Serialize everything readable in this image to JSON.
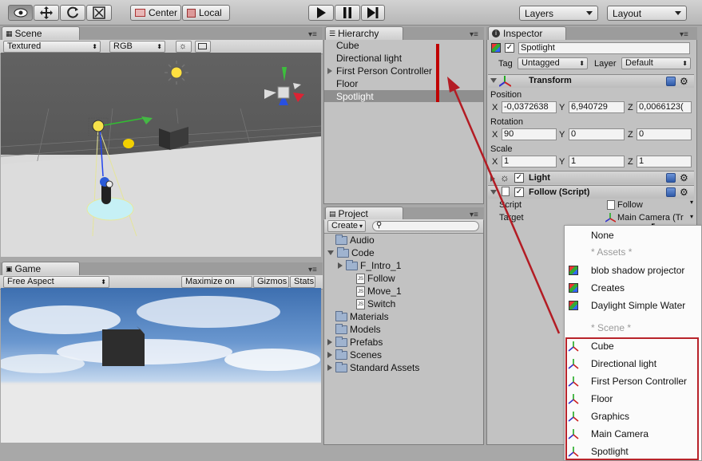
{
  "toolbar": {
    "tools": [
      "view-icon",
      "move-icon",
      "rotate-icon",
      "scale-icon"
    ],
    "pivot_label": "Center",
    "space_label": "Local",
    "layers_label": "Layers",
    "layout_label": "Layout"
  },
  "scene": {
    "tab_label": "Scene",
    "render_mode": "Textured",
    "color_mode": "RGB"
  },
  "game": {
    "tab_label": "Game",
    "aspect": "Free Aspect",
    "maximize_label": "Maximize on Play",
    "gizmos_label": "Gizmos",
    "stats_label": "Stats"
  },
  "hierarchy": {
    "tab_label": "Hierarchy",
    "items": [
      "Cube",
      "Directional light",
      "First Person Controller",
      "Floor",
      "Spotlight"
    ],
    "selected": "Spotlight"
  },
  "project": {
    "tab_label": "Project",
    "create_label": "Create",
    "tree": [
      {
        "label": "Audio",
        "kind": "folder",
        "indent": 0,
        "arrow": ""
      },
      {
        "label": "Code",
        "kind": "folder",
        "indent": 0,
        "arrow": "down"
      },
      {
        "label": "F_Intro_1",
        "kind": "folder",
        "indent": 1,
        "arrow": "right"
      },
      {
        "label": "Follow",
        "kind": "js",
        "indent": 2,
        "arrow": ""
      },
      {
        "label": "Move_1",
        "kind": "js",
        "indent": 2,
        "arrow": ""
      },
      {
        "label": "Switch",
        "kind": "js",
        "indent": 2,
        "arrow": ""
      },
      {
        "label": "Materials",
        "kind": "folder",
        "indent": 0,
        "arrow": ""
      },
      {
        "label": "Models",
        "kind": "folder",
        "indent": 0,
        "arrow": ""
      },
      {
        "label": "Prefabs",
        "kind": "folder",
        "indent": 0,
        "arrow": "right"
      },
      {
        "label": "Scenes",
        "kind": "folder",
        "indent": 0,
        "arrow": "right"
      },
      {
        "label": "Standard Assets",
        "kind": "folder",
        "indent": 0,
        "arrow": "right"
      }
    ]
  },
  "inspector": {
    "tab_label": "Inspector",
    "object_name": "Spotlight",
    "tag_label": "Tag",
    "tag_value": "Untagged",
    "layer_label": "Layer",
    "layer_value": "Default",
    "transform": {
      "title": "Transform",
      "position_label": "Position",
      "position": {
        "x": "-0,0372638",
        "y": "6,940729",
        "z": "0,0066123("
      },
      "rotation_label": "Rotation",
      "rotation": {
        "x": "90",
        "y": "0",
        "z": "0"
      },
      "scale_label": "Scale",
      "scale": {
        "x": "1",
        "y": "1",
        "z": "1"
      }
    },
    "light_title": "Light",
    "follow": {
      "title": "Follow (Script)",
      "script_label": "Script",
      "script_value": "Follow",
      "target_label": "Target",
      "target_value": "Main Camera (Tr"
    }
  },
  "popup": {
    "none_label": "None",
    "assets_header": "* Assets *",
    "assets": [
      "blob shadow projector",
      "Creates",
      "Daylight Simple Water"
    ],
    "scene_header": "* Scene *",
    "scene_items": [
      "Cube",
      "Directional light",
      "First Person Controller",
      "Floor",
      "Graphics",
      "Main Camera",
      "Spotlight"
    ]
  },
  "colors": {
    "annotation_red": "#c00000",
    "selection_gray": "#8f8f8f"
  }
}
